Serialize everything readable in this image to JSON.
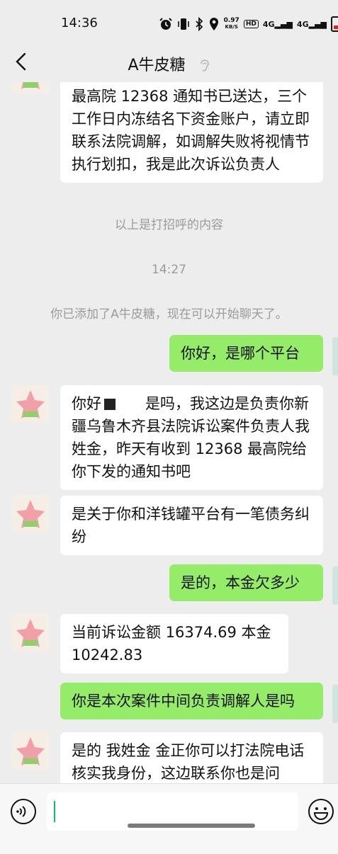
{
  "status_bar": {
    "time": "14:36",
    "net_speed_value": "0.97",
    "net_speed_unit": "KB/S",
    "hd_label": "HD",
    "signal1": "4G",
    "signal2": "4G",
    "icons": [
      "alarm-icon",
      "vibrate-icon",
      "bluetooth-icon",
      "location-icon",
      "battery-icon"
    ]
  },
  "nav": {
    "title": "A牛皮糖",
    "back_icon": "chevron-left-icon",
    "ear_icon": "ear-icon"
  },
  "messages": [
    {
      "side": "in",
      "text": "最高院 12368 通知书已送达，三个工作日内冻结名下资金账户，请立即联系法院调解，如调解失败将视情节执行划扣，我是此次诉讼负责人"
    },
    {
      "side": "system",
      "text": "以上是打招呼的内容"
    },
    {
      "side": "system",
      "text": "14:27"
    },
    {
      "side": "system",
      "text": "你已添加了A牛皮糖，现在可以开始聊天了。"
    },
    {
      "side": "out",
      "text": "你好，是哪个平台"
    },
    {
      "side": "in",
      "text_before": "你好",
      "text_after": "是吗，我这边是负责你新疆乌鲁木齐县法院诉讼案件负责人我姓金，昨天有收到 12368 最高院给你下发的通知书吧"
    },
    {
      "side": "in",
      "text": "是关于你和洋钱罐平台有一笔债务纠纷"
    },
    {
      "side": "out",
      "text": "是的，本金欠多少"
    },
    {
      "side": "in",
      "text": "当前诉讼金额 16374.69 本金 10242.83"
    },
    {
      "side": "out",
      "text": "你是本次案件中间负责调解人是吗"
    },
    {
      "side": "in",
      "text": "是的 我姓金 金正你可以打法院电话核实我身份，这边联系你也是问"
    }
  ],
  "input": {
    "value": "",
    "voice_icon": "voice-icon",
    "emoji_icon": "emoji-icon"
  }
}
